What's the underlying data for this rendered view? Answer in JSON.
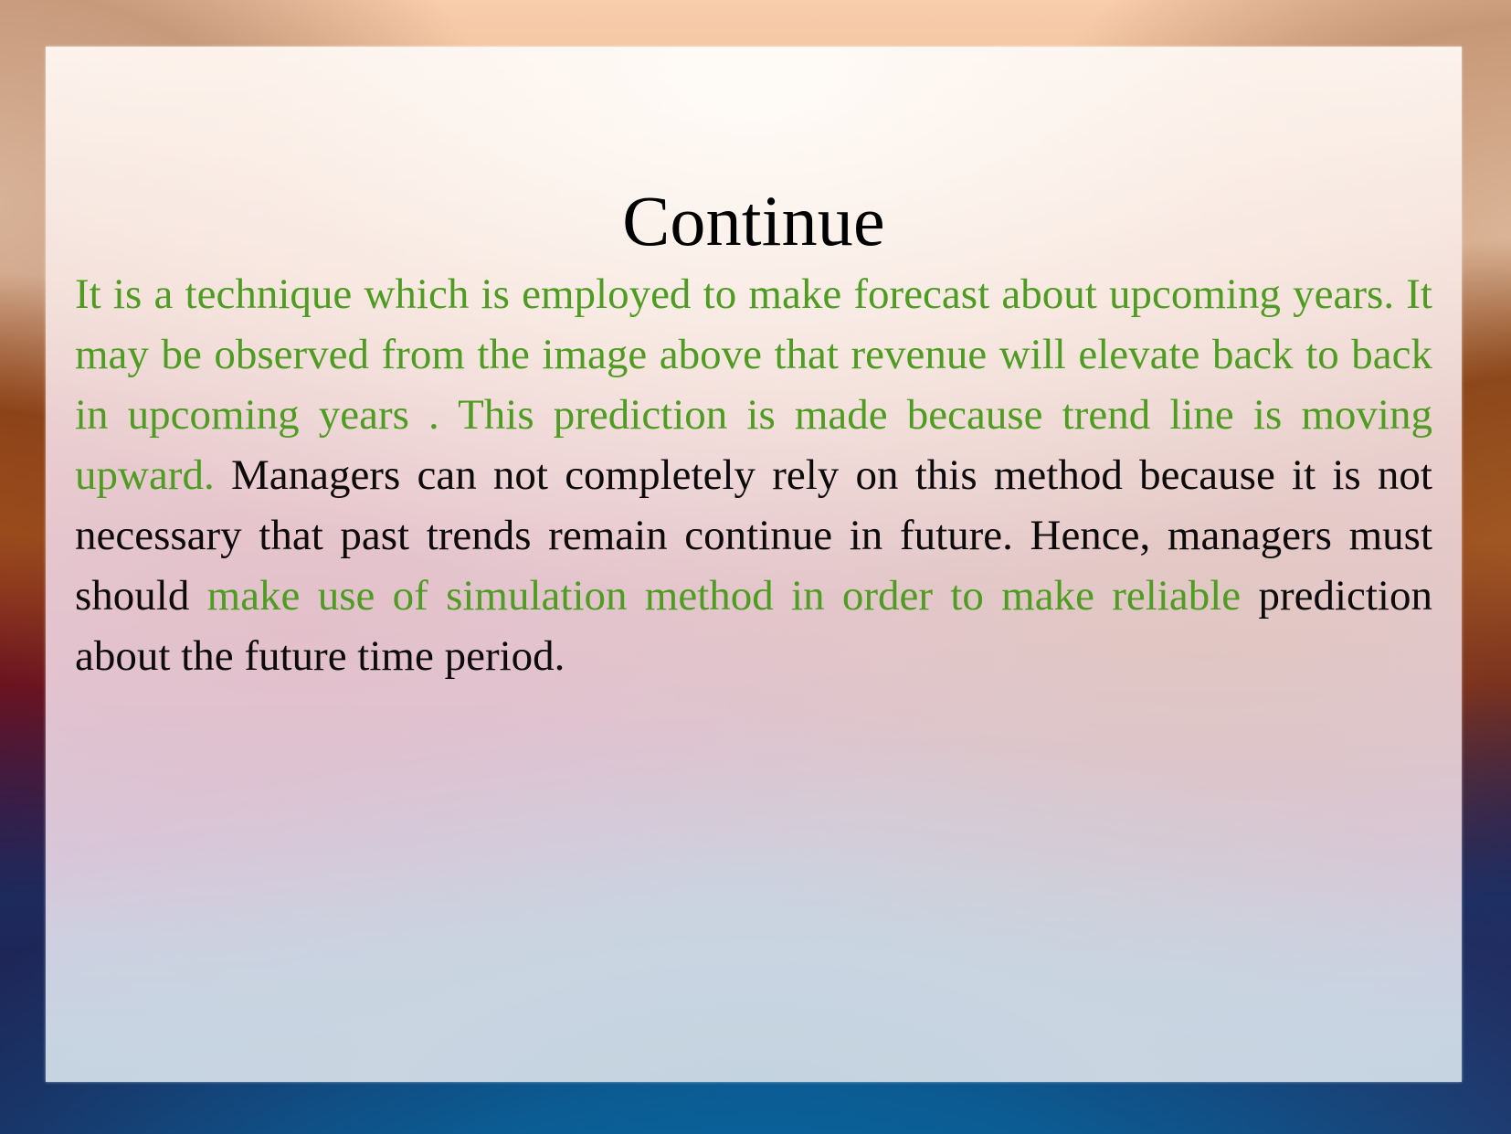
{
  "slide": {
    "title": "Continue",
    "colors": {
      "green_text": "#4f9c22",
      "black_text": "#0d0a0c",
      "panel_top": "#fbf3ed",
      "panel_bottom": "#c4d3e1",
      "frame_top": "#f5c4a1",
      "frame_bottom": "#0a5f96",
      "frame_left_mid": "#8d4319",
      "frame_corner_dark": "#1d2a5c"
    },
    "body": {
      "segments": [
        {
          "color": "green",
          "text": "It is a technique which is employed to make forecast about upcoming years. It may be observed from the image above that revenue will elevate back to back in upcoming years . This prediction is made because trend line is moving upward. "
        },
        {
          "color": "black",
          "text": "Managers can not completely rely on this method because it is not necessary that past trends remain continue in future. Hence, managers must should "
        },
        {
          "color": "green",
          "text": "make use of simulation method in order to make reliable "
        },
        {
          "color": "black",
          "text": "prediction about the future time period."
        }
      ],
      "full_text": "It is a technique which is employed to make forecast about upcoming years. It may be observed from the image above that revenue will elevate back to back in upcoming years . This prediction is made because trend line is moving upward. Managers can not completely rely on this method because it is not necessary that past trends remain continue in future. Hence, managers must should make use of simulation method in order to make reliable prediction about the future time period."
    }
  }
}
